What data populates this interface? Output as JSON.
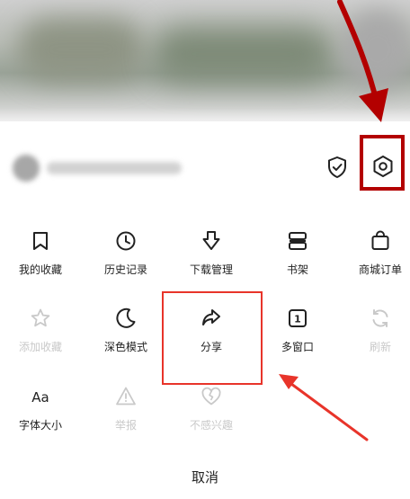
{
  "menu": {
    "row1": [
      {
        "label": "我的收藏",
        "icon": "bookmark-icon"
      },
      {
        "label": "历史记录",
        "icon": "clock-icon"
      },
      {
        "label": "下载管理",
        "icon": "download-icon"
      },
      {
        "label": "书架",
        "icon": "bookshelf-icon"
      },
      {
        "label": "商城订单",
        "icon": "shopping-bag-icon"
      }
    ],
    "row2": [
      {
        "label": "添加收藏",
        "icon": "star-icon",
        "disabled": true
      },
      {
        "label": "深色模式",
        "icon": "moon-icon"
      },
      {
        "label": "分享",
        "icon": "share-icon"
      },
      {
        "label": "多窗口",
        "icon": "window-count-icon",
        "badge": "1"
      },
      {
        "label": "刷新",
        "icon": "refresh-icon",
        "disabled": true
      }
    ],
    "row3": [
      {
        "label": "字体大小",
        "icon": "font-size-icon",
        "glyph": "Aa"
      },
      {
        "label": "举报",
        "icon": "warning-icon",
        "disabled": true
      },
      {
        "label": "不感兴趣",
        "icon": "broken-heart-icon",
        "disabled": true
      }
    ]
  },
  "cancel_label": "取消",
  "colors": {
    "annotation_dark_red": "#b30000",
    "annotation_red": "#e8342a",
    "text": "#222222",
    "disabled": "#c9c9c9"
  }
}
